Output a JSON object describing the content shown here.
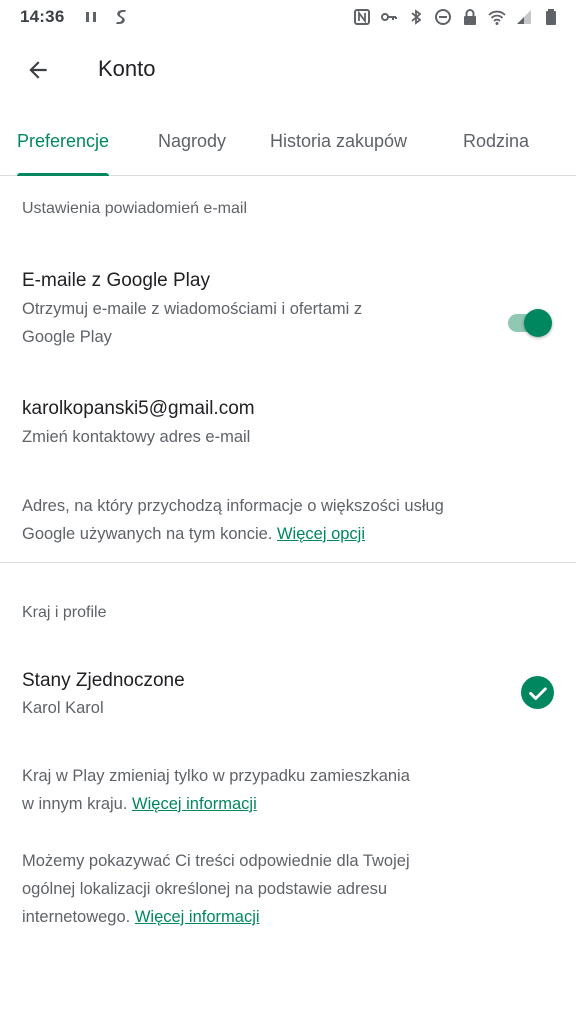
{
  "status_bar": {
    "time": "14:36",
    "left_icons": [
      "pause-icon",
      "shazam-icon"
    ],
    "right_icons": [
      "nfc-icon",
      "vpn-key-icon",
      "bluetooth-icon",
      "do-not-disturb-icon",
      "lock-icon",
      "wifi-icon",
      "signal-icon",
      "battery-icon"
    ]
  },
  "app_bar": {
    "title": "Konto"
  },
  "tabs": [
    {
      "label": "Preferencje",
      "active": true
    },
    {
      "label": "Nagrody",
      "active": false
    },
    {
      "label": "Historia zakupów",
      "active": false
    },
    {
      "label": "Rodzina",
      "active": false
    }
  ],
  "email_section": {
    "header": "Ustawienia powiadomień e-mail",
    "google_play_emails": {
      "title": "E-maile z Google Play",
      "subtitle_line1": "Otrzymuj e-maile z wiadomościami i ofertami z",
      "subtitle_line2": "Google Play",
      "enabled": true
    },
    "contact_email": {
      "title": "karolkopanski5@gmail.com",
      "subtitle": "Zmień kontaktowy adres e-mail"
    },
    "info_line1": "Adres, na który przychodzą informacje o większości usług",
    "info_line2": "Google używanych na tym koncie.",
    "info_link": "Więcej opcji"
  },
  "country_section": {
    "header": "Kraj i profile",
    "country": {
      "title": "Stany Zjednoczone",
      "subtitle": "Karol Karol",
      "selected": true
    },
    "info1_line1": "Kraj w Play zmieniaj tylko w przypadku zamieszkania",
    "info1_line2": "w innym kraju.",
    "info1_link": "Więcej informacji",
    "info2_line1": "Możemy pokazywać Ci treści odpowiednie dla Twojej",
    "info2_line2": "ogólnej lokalizacji określonej na podstawie adresu",
    "info2_line3": "internetowego.",
    "info2_link": "Więcej informacji"
  },
  "colors": {
    "accent": "#01875f",
    "text_primary": "#202124",
    "text_secondary": "#5f6368",
    "divider": "#dadce0"
  }
}
